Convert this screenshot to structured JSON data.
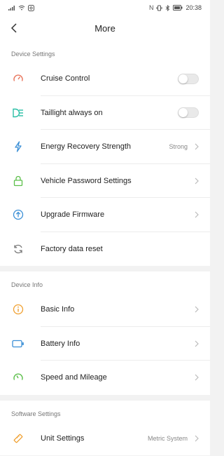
{
  "status_bar": {
    "time": "20:38",
    "left_icons": [
      "signal-icon",
      "wifi-icon",
      "notification-icon"
    ],
    "right_icons": [
      "nfc-icon",
      "vibrate-icon",
      "bluetooth-icon",
      "battery-icon"
    ]
  },
  "nav": {
    "title": "More",
    "back_icon": "chevron-left-icon"
  },
  "sections": {
    "device_settings": {
      "header": "Device Settings",
      "items": [
        {
          "label": "Cruise Control",
          "icon": "speedometer-icon",
          "control": "toggle",
          "on": false,
          "color": "#e8735a"
        },
        {
          "label": "Taillight always on",
          "icon": "taillight-icon",
          "control": "toggle",
          "on": false,
          "color": "#2bbfa6"
        },
        {
          "label": "Energy Recovery Strength",
          "icon": "lightning-icon",
          "control": "chevron",
          "value": "Strong",
          "color": "#3b8fd6"
        },
        {
          "label": "Vehicle Password Settings",
          "icon": "lock-icon",
          "control": "chevron",
          "color": "#5cbf4a"
        },
        {
          "label": "Upgrade Firmware",
          "icon": "upload-circle-icon",
          "control": "chevron",
          "color": "#3b8fd6"
        },
        {
          "label": "Factory data reset",
          "icon": "refresh-icon",
          "control": "none",
          "color": "#777777"
        }
      ]
    },
    "device_info": {
      "header": "Device Info",
      "items": [
        {
          "label": "Basic Info",
          "icon": "info-circle-icon",
          "control": "chevron",
          "color": "#f0a030"
        },
        {
          "label": "Battery Info",
          "icon": "battery-outline-icon",
          "control": "chevron",
          "color": "#3b8fd6"
        },
        {
          "label": "Speed and Mileage",
          "icon": "gauge-icon",
          "control": "chevron",
          "color": "#5cbf4a"
        }
      ]
    },
    "software_settings": {
      "header": "Software Settings",
      "items": [
        {
          "label": "Unit Settings",
          "icon": "ruler-icon",
          "control": "chevron",
          "value": "Metric System",
          "color": "#f0a030"
        }
      ]
    }
  }
}
